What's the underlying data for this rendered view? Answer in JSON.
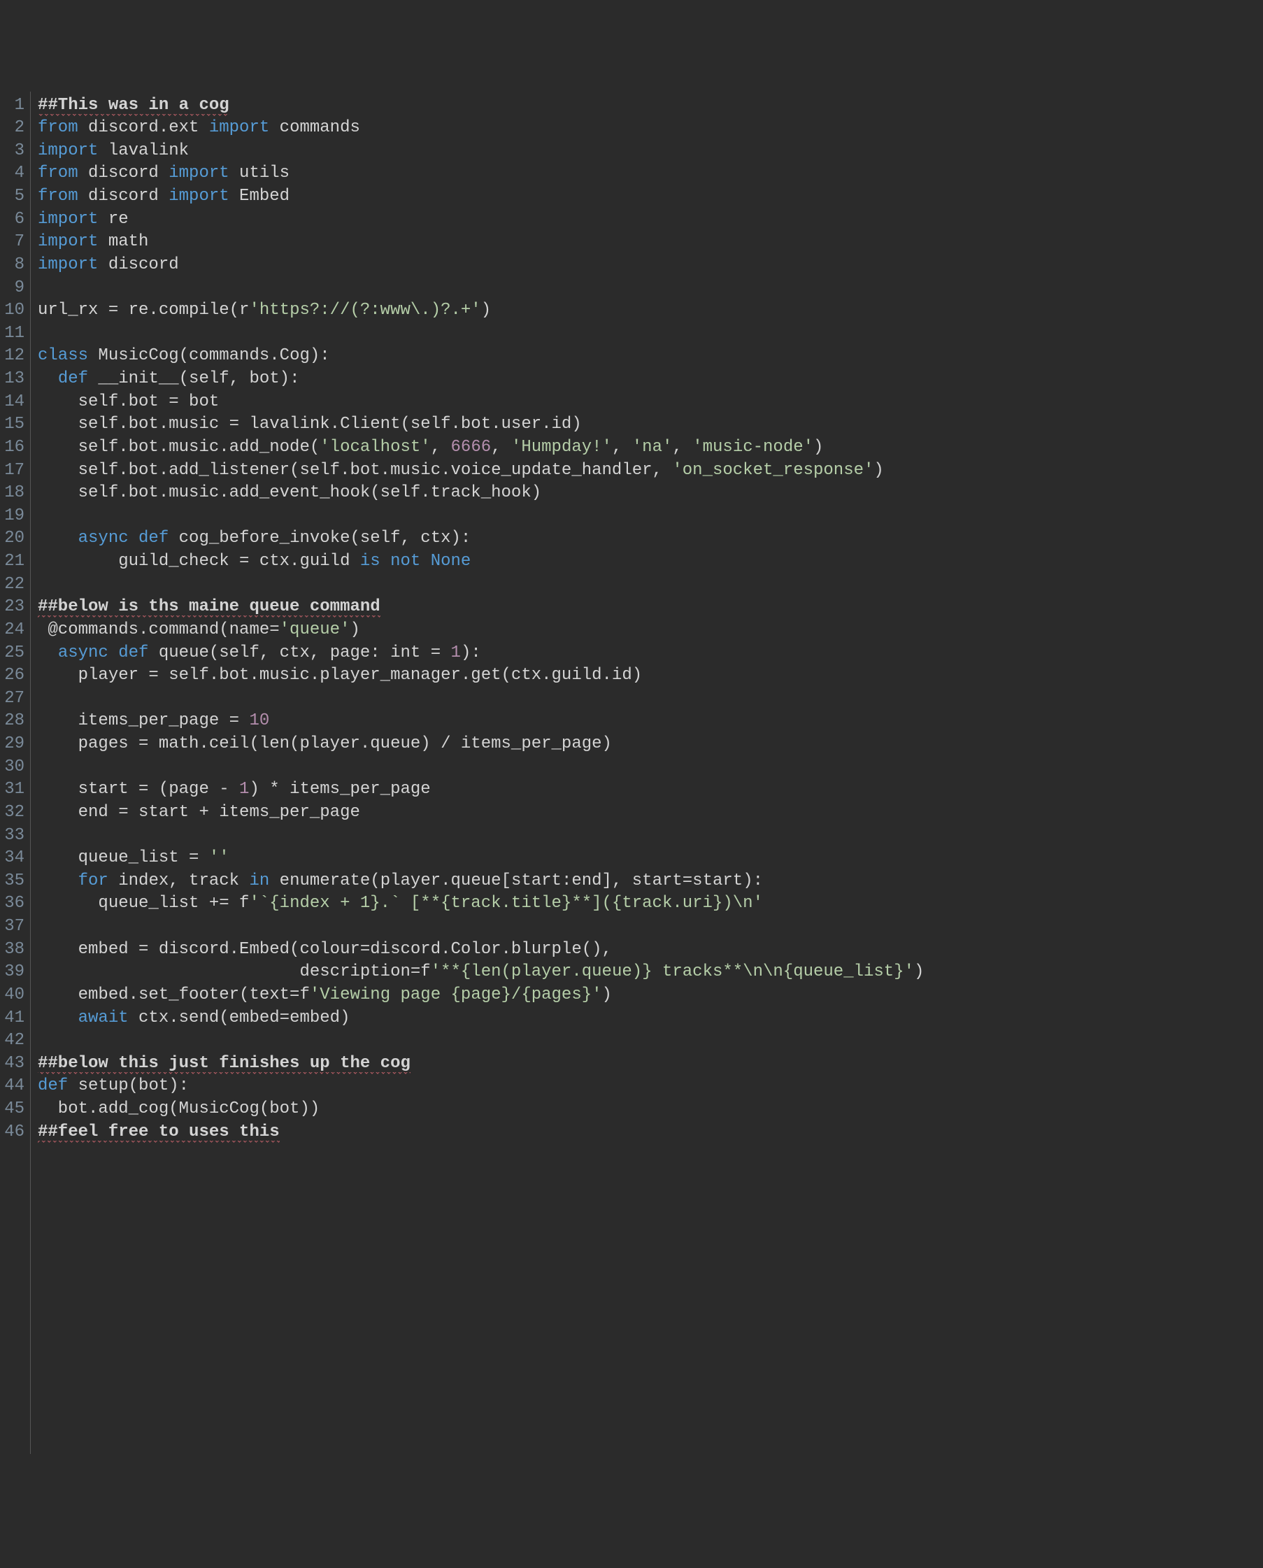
{
  "lines": [
    {
      "num": 1,
      "tokens": [
        {
          "t": "##This was in a cog",
          "c": "tok-comment squiggly"
        }
      ]
    },
    {
      "num": 2,
      "tokens": [
        {
          "t": "from",
          "c": "tok-keyword"
        },
        {
          "t": " discord.ext ",
          "c": "tok-plain"
        },
        {
          "t": "import",
          "c": "tok-keyword"
        },
        {
          "t": " commands",
          "c": "tok-plain"
        }
      ]
    },
    {
      "num": 3,
      "tokens": [
        {
          "t": "import",
          "c": "tok-keyword"
        },
        {
          "t": " lavalink",
          "c": "tok-plain"
        }
      ]
    },
    {
      "num": 4,
      "tokens": [
        {
          "t": "from",
          "c": "tok-keyword"
        },
        {
          "t": " discord ",
          "c": "tok-plain"
        },
        {
          "t": "import",
          "c": "tok-keyword"
        },
        {
          "t": " utils",
          "c": "tok-plain"
        }
      ]
    },
    {
      "num": 5,
      "tokens": [
        {
          "t": "from",
          "c": "tok-keyword"
        },
        {
          "t": " discord ",
          "c": "tok-plain"
        },
        {
          "t": "import",
          "c": "tok-keyword"
        },
        {
          "t": " Embed",
          "c": "tok-plain"
        }
      ]
    },
    {
      "num": 6,
      "tokens": [
        {
          "t": "import",
          "c": "tok-keyword"
        },
        {
          "t": " re",
          "c": "tok-plain"
        }
      ]
    },
    {
      "num": 7,
      "tokens": [
        {
          "t": "import",
          "c": "tok-keyword"
        },
        {
          "t": " math",
          "c": "tok-plain"
        }
      ]
    },
    {
      "num": 8,
      "tokens": [
        {
          "t": "import",
          "c": "tok-keyword"
        },
        {
          "t": " discord",
          "c": "tok-plain"
        }
      ]
    },
    {
      "num": 9,
      "tokens": [
        {
          "t": "",
          "c": "tok-plain"
        }
      ]
    },
    {
      "num": 10,
      "tokens": [
        {
          "t": "url_rx = re.compile(r",
          "c": "tok-plain"
        },
        {
          "t": "'https?://(?:www\\.)?.+'",
          "c": "tok-string2"
        },
        {
          "t": ")",
          "c": "tok-plain"
        }
      ]
    },
    {
      "num": 11,
      "tokens": [
        {
          "t": "",
          "c": "tok-plain"
        }
      ]
    },
    {
      "num": 12,
      "tokens": [
        {
          "t": "class",
          "c": "tok-keyword"
        },
        {
          "t": " MusicCog(commands.Cog):",
          "c": "tok-plain"
        }
      ]
    },
    {
      "num": 13,
      "tokens": [
        {
          "t": "  ",
          "c": "tok-plain"
        },
        {
          "t": "def",
          "c": "tok-keyword"
        },
        {
          "t": " __init__(self, bot):",
          "c": "tok-plain"
        }
      ]
    },
    {
      "num": 14,
      "tokens": [
        {
          "t": "    self.bot = bot",
          "c": "tok-plain"
        }
      ]
    },
    {
      "num": 15,
      "tokens": [
        {
          "t": "    self.bot.music = lavalink.Client(self.bot.user.id)",
          "c": "tok-plain"
        }
      ]
    },
    {
      "num": 16,
      "tokens": [
        {
          "t": "    self.bot.music.add_node(",
          "c": "tok-plain"
        },
        {
          "t": "'localhost'",
          "c": "tok-string2"
        },
        {
          "t": ", ",
          "c": "tok-plain"
        },
        {
          "t": "6666",
          "c": "tok-number"
        },
        {
          "t": ", ",
          "c": "tok-plain"
        },
        {
          "t": "'Humpday!'",
          "c": "tok-string2"
        },
        {
          "t": ", ",
          "c": "tok-plain"
        },
        {
          "t": "'na'",
          "c": "tok-string2"
        },
        {
          "t": ", ",
          "c": "tok-plain"
        },
        {
          "t": "'music-node'",
          "c": "tok-string2"
        },
        {
          "t": ")",
          "c": "tok-plain"
        }
      ]
    },
    {
      "num": 17,
      "tokens": [
        {
          "t": "    self.bot.add_listener(self.bot.music.voice_update_handler, ",
          "c": "tok-plain"
        },
        {
          "t": "'on_socket_response'",
          "c": "tok-string2"
        },
        {
          "t": ")",
          "c": "tok-plain"
        }
      ]
    },
    {
      "num": 18,
      "tokens": [
        {
          "t": "    self.bot.music.add_event_hook(self.track_hook)",
          "c": "tok-plain"
        }
      ]
    },
    {
      "num": 19,
      "tokens": [
        {
          "t": "",
          "c": "tok-plain"
        }
      ]
    },
    {
      "num": 20,
      "tokens": [
        {
          "t": "    ",
          "c": "tok-plain"
        },
        {
          "t": "async",
          "c": "tok-keyword"
        },
        {
          "t": " ",
          "c": "tok-plain"
        },
        {
          "t": "def",
          "c": "tok-keyword"
        },
        {
          "t": " cog_before_invoke(self, ctx):",
          "c": "tok-plain"
        }
      ]
    },
    {
      "num": 21,
      "tokens": [
        {
          "t": "        guild_check = ctx.guild ",
          "c": "tok-plain"
        },
        {
          "t": "is not",
          "c": "tok-keyword"
        },
        {
          "t": " ",
          "c": "tok-plain"
        },
        {
          "t": "None",
          "c": "tok-keyword"
        }
      ]
    },
    {
      "num": 22,
      "tokens": [
        {
          "t": "",
          "c": "tok-plain"
        }
      ]
    },
    {
      "num": 23,
      "tokens": [
        {
          "t": "##below is ths maine queue command",
          "c": "tok-comment squiggly"
        }
      ]
    },
    {
      "num": 24,
      "tokens": [
        {
          "t": " @commands.command(name=",
          "c": "tok-plain"
        },
        {
          "t": "'queue'",
          "c": "tok-string2"
        },
        {
          "t": ")",
          "c": "tok-plain"
        }
      ]
    },
    {
      "num": 25,
      "tokens": [
        {
          "t": "  ",
          "c": "tok-plain"
        },
        {
          "t": "async",
          "c": "tok-keyword"
        },
        {
          "t": " ",
          "c": "tok-plain"
        },
        {
          "t": "def",
          "c": "tok-keyword"
        },
        {
          "t": " queue(self, ctx, page: int = ",
          "c": "tok-plain"
        },
        {
          "t": "1",
          "c": "tok-number"
        },
        {
          "t": "):",
          "c": "tok-plain"
        }
      ]
    },
    {
      "num": 26,
      "tokens": [
        {
          "t": "    player = self.bot.music.player_manager.get(ctx.guild.id)",
          "c": "tok-plain"
        }
      ]
    },
    {
      "num": 27,
      "tokens": [
        {
          "t": "",
          "c": "tok-plain"
        }
      ]
    },
    {
      "num": 28,
      "tokens": [
        {
          "t": "    items_per_page = ",
          "c": "tok-plain"
        },
        {
          "t": "10",
          "c": "tok-number"
        }
      ]
    },
    {
      "num": 29,
      "tokens": [
        {
          "t": "    pages = math.ceil(len(player.queue) / items_per_page)",
          "c": "tok-plain"
        }
      ]
    },
    {
      "num": 30,
      "tokens": [
        {
          "t": "",
          "c": "tok-plain"
        }
      ]
    },
    {
      "num": 31,
      "tokens": [
        {
          "t": "    start = (page - ",
          "c": "tok-plain"
        },
        {
          "t": "1",
          "c": "tok-number"
        },
        {
          "t": ") * items_per_page",
          "c": "tok-plain"
        }
      ]
    },
    {
      "num": 32,
      "tokens": [
        {
          "t": "    end = start + items_per_page",
          "c": "tok-plain"
        }
      ]
    },
    {
      "num": 33,
      "tokens": [
        {
          "t": "",
          "c": "tok-plain"
        }
      ]
    },
    {
      "num": 34,
      "tokens": [
        {
          "t": "    queue_list = ",
          "c": "tok-plain"
        },
        {
          "t": "''",
          "c": "tok-string2"
        }
      ]
    },
    {
      "num": 35,
      "tokens": [
        {
          "t": "    ",
          "c": "tok-plain"
        },
        {
          "t": "for",
          "c": "tok-keyword"
        },
        {
          "t": " index, track ",
          "c": "tok-plain"
        },
        {
          "t": "in",
          "c": "tok-keyword"
        },
        {
          "t": " enumerate(player.queue[start:end], start=start):",
          "c": "tok-plain"
        }
      ]
    },
    {
      "num": 36,
      "tokens": [
        {
          "t": "      queue_list += f",
          "c": "tok-plain"
        },
        {
          "t": "'`{index + 1}.` [**{track.title}**]({track.uri})\\n'",
          "c": "tok-string2"
        }
      ]
    },
    {
      "num": 37,
      "tokens": [
        {
          "t": "",
          "c": "tok-plain"
        }
      ]
    },
    {
      "num": 38,
      "tokens": [
        {
          "t": "    embed = discord.Embed(colour=discord.Color.blurple(),",
          "c": "tok-plain"
        }
      ]
    },
    {
      "num": 39,
      "tokens": [
        {
          "t": "                          description=f",
          "c": "tok-plain"
        },
        {
          "t": "'**{len(player.queue)} tracks**\\n\\n{queue_list}'",
          "c": "tok-string2"
        },
        {
          "t": ")",
          "c": "tok-plain"
        }
      ]
    },
    {
      "num": 40,
      "tokens": [
        {
          "t": "    embed.set_footer(text=f",
          "c": "tok-plain"
        },
        {
          "t": "'Viewing page {page}/{pages}'",
          "c": "tok-string2"
        },
        {
          "t": ")",
          "c": "tok-plain"
        }
      ]
    },
    {
      "num": 41,
      "tokens": [
        {
          "t": "    ",
          "c": "tok-plain"
        },
        {
          "t": "await",
          "c": "tok-keyword"
        },
        {
          "t": " ctx.send(embed=embed)",
          "c": "tok-plain"
        }
      ]
    },
    {
      "num": 42,
      "tokens": [
        {
          "t": "",
          "c": "tok-plain"
        }
      ]
    },
    {
      "num": 43,
      "tokens": [
        {
          "t": "##below this just finishes up the cog",
          "c": "tok-comment squiggly"
        }
      ]
    },
    {
      "num": 44,
      "tokens": [
        {
          "t": "def",
          "c": "tok-keyword"
        },
        {
          "t": " setup(bot):",
          "c": "tok-plain"
        }
      ]
    },
    {
      "num": 45,
      "tokens": [
        {
          "t": "  bot.add_cog(MusicCog(bot))",
          "c": "tok-plain"
        }
      ]
    },
    {
      "num": 46,
      "tokens": [
        {
          "t": "##feel free to uses this",
          "c": "tok-comment squiggly"
        }
      ]
    }
  ]
}
